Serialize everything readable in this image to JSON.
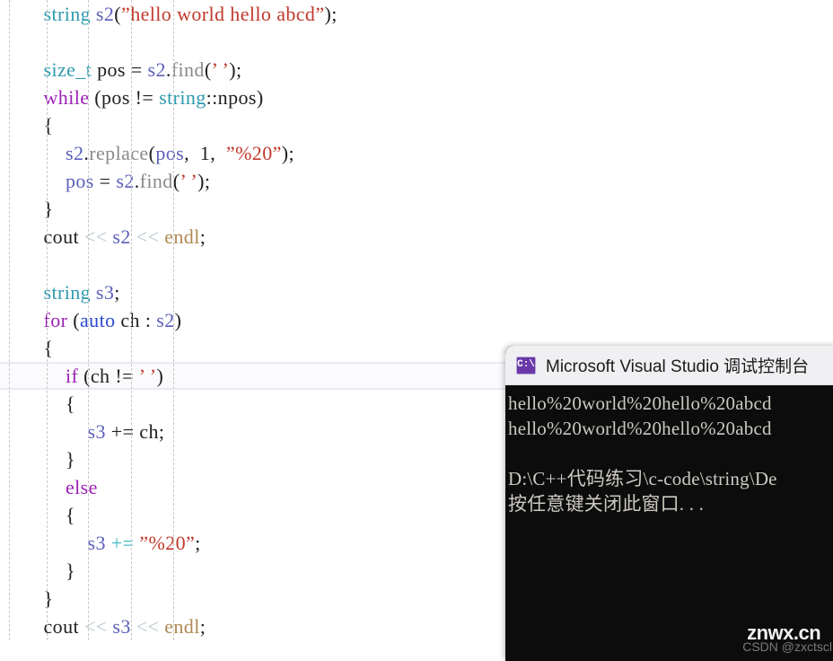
{
  "editor": {
    "font_size_px": 22,
    "line_height_px": 31,
    "background": "#ffffff",
    "current_line_index": 13,
    "indent_guides_x": [
      10,
      52,
      98,
      146,
      193
    ],
    "colors": {
      "type": "#2e9ab0",
      "keyword": "#9b20b5",
      "keyword_alt": "#2b4ad0",
      "variable": "#5a5fb8",
      "string": "#c0392b",
      "function": "#8a8a8a",
      "plain": "#202020",
      "operator_shift": "#b9c6cd",
      "operator_plus_eq": "#38b8c4",
      "endl": "#b08a55",
      "indent_guide": "#c9c9c9",
      "current_line_border": "#eaeaf0"
    },
    "lines": [
      {
        "indent": 2,
        "tokens": [
          {
            "t": "string",
            "c": "type"
          },
          {
            "t": " ",
            "c": "plain"
          },
          {
            "t": "s2",
            "c": "variable"
          },
          {
            "t": "(",
            "c": "plain"
          },
          {
            "t": "”hello world hello abcd”",
            "c": "string"
          },
          {
            "t": ");",
            "c": "plain"
          }
        ]
      },
      {
        "indent": 2,
        "tokens": []
      },
      {
        "indent": 2,
        "tokens": [
          {
            "t": "size_t",
            "c": "type"
          },
          {
            "t": " pos = ",
            "c": "plain"
          },
          {
            "t": "s2",
            "c": "variable"
          },
          {
            "t": ".",
            "c": "plain"
          },
          {
            "t": "find",
            "c": "function"
          },
          {
            "t": "(",
            "c": "plain"
          },
          {
            "t": "’ ’",
            "c": "string"
          },
          {
            "t": ");",
            "c": "plain"
          }
        ]
      },
      {
        "indent": 2,
        "tokens": [
          {
            "t": "while",
            "c": "keyword"
          },
          {
            "t": " (pos != ",
            "c": "plain"
          },
          {
            "t": "string",
            "c": "type"
          },
          {
            "t": "::npos)",
            "c": "plain"
          }
        ]
      },
      {
        "indent": 2,
        "tokens": [
          {
            "t": "{",
            "c": "plain"
          }
        ]
      },
      {
        "indent": 4,
        "tokens": [
          {
            "t": "s2",
            "c": "variable"
          },
          {
            "t": ".",
            "c": "plain"
          },
          {
            "t": "replace",
            "c": "function"
          },
          {
            "t": "(",
            "c": "plain"
          },
          {
            "t": "pos",
            "c": "variable"
          },
          {
            "t": ",  1,  ",
            "c": "plain"
          },
          {
            "t": "”%20”",
            "c": "string"
          },
          {
            "t": ");",
            "c": "plain"
          }
        ]
      },
      {
        "indent": 4,
        "tokens": [
          {
            "t": "pos",
            "c": "variable"
          },
          {
            "t": " = ",
            "c": "plain"
          },
          {
            "t": "s2",
            "c": "variable"
          },
          {
            "t": ".",
            "c": "plain"
          },
          {
            "t": "find",
            "c": "function"
          },
          {
            "t": "(",
            "c": "plain"
          },
          {
            "t": "’ ’",
            "c": "string"
          },
          {
            "t": ");",
            "c": "plain"
          }
        ]
      },
      {
        "indent": 2,
        "tokens": [
          {
            "t": "}",
            "c": "plain"
          }
        ]
      },
      {
        "indent": 2,
        "tokens": [
          {
            "t": "cout ",
            "c": "plain"
          },
          {
            "t": "<<",
            "c": "operator_shift"
          },
          {
            "t": " ",
            "c": "plain"
          },
          {
            "t": "s2",
            "c": "variable"
          },
          {
            "t": " ",
            "c": "plain"
          },
          {
            "t": "<<",
            "c": "operator_shift"
          },
          {
            "t": " ",
            "c": "plain"
          },
          {
            "t": "endl",
            "c": "endl"
          },
          {
            "t": ";",
            "c": "plain"
          }
        ]
      },
      {
        "indent": 2,
        "tokens": []
      },
      {
        "indent": 2,
        "tokens": [
          {
            "t": "string",
            "c": "type"
          },
          {
            "t": " ",
            "c": "plain"
          },
          {
            "t": "s3",
            "c": "variable"
          },
          {
            "t": ";",
            "c": "plain"
          }
        ]
      },
      {
        "indent": 2,
        "tokens": [
          {
            "t": "for",
            "c": "keyword"
          },
          {
            "t": " (",
            "c": "plain"
          },
          {
            "t": "auto",
            "c": "keyword_alt"
          },
          {
            "t": " ch : ",
            "c": "plain"
          },
          {
            "t": "s2",
            "c": "variable"
          },
          {
            "t": ")",
            "c": "plain"
          }
        ]
      },
      {
        "indent": 2,
        "tokens": [
          {
            "t": "{",
            "c": "plain"
          }
        ]
      },
      {
        "indent": 4,
        "tokens": [
          {
            "t": "if",
            "c": "keyword"
          },
          {
            "t": " (ch != ",
            "c": "plain"
          },
          {
            "t": "’ ’",
            "c": "string"
          },
          {
            "t": ")",
            "c": "plain"
          }
        ]
      },
      {
        "indent": 4,
        "tokens": [
          {
            "t": "{",
            "c": "plain"
          }
        ]
      },
      {
        "indent": 6,
        "tokens": [
          {
            "t": "s3",
            "c": "variable"
          },
          {
            "t": " += ch;",
            "c": "plain"
          }
        ]
      },
      {
        "indent": 4,
        "tokens": [
          {
            "t": "}",
            "c": "plain"
          }
        ]
      },
      {
        "indent": 4,
        "tokens": [
          {
            "t": "else",
            "c": "keyword"
          }
        ]
      },
      {
        "indent": 4,
        "tokens": [
          {
            "t": "{",
            "c": "plain"
          }
        ]
      },
      {
        "indent": 6,
        "tokens": [
          {
            "t": "s3",
            "c": "variable"
          },
          {
            "t": " ",
            "c": "plain"
          },
          {
            "t": "+=",
            "c": "operator_plus_eq"
          },
          {
            "t": " ",
            "c": "plain"
          },
          {
            "t": "”%20”",
            "c": "string"
          },
          {
            "t": ";",
            "c": "plain"
          }
        ]
      },
      {
        "indent": 4,
        "tokens": [
          {
            "t": "}",
            "c": "plain"
          }
        ]
      },
      {
        "indent": 2,
        "tokens": [
          {
            "t": "}",
            "c": "plain"
          }
        ]
      },
      {
        "indent": 2,
        "tokens": [
          {
            "t": "cout ",
            "c": "plain"
          },
          {
            "t": "<<",
            "c": "operator_shift"
          },
          {
            "t": " ",
            "c": "plain"
          },
          {
            "t": "s3",
            "c": "variable"
          },
          {
            "t": " ",
            "c": "plain"
          },
          {
            "t": "<<",
            "c": "operator_shift"
          },
          {
            "t": " ",
            "c": "plain"
          },
          {
            "t": "endl",
            "c": "endl"
          },
          {
            "t": ";",
            "c": "plain"
          }
        ]
      }
    ]
  },
  "console": {
    "icon": "command-prompt-icon",
    "icon_glyph": "C:\\",
    "icon_color": "#6a38a8",
    "title": "Microsoft Visual Studio 调试控制台",
    "background": "#0c0c0c",
    "text_color": "#ccc9c2",
    "lines": [
      "hello%20world%20hello%20abcd",
      "hello%20world%20hello%20abcd",
      "",
      "D:\\C++代码练习\\c-code\\string\\De",
      "按任意键关闭此窗口. . ."
    ]
  },
  "watermark": {
    "main": "znwx.cn",
    "sub": "CSDN @zxctscl"
  }
}
